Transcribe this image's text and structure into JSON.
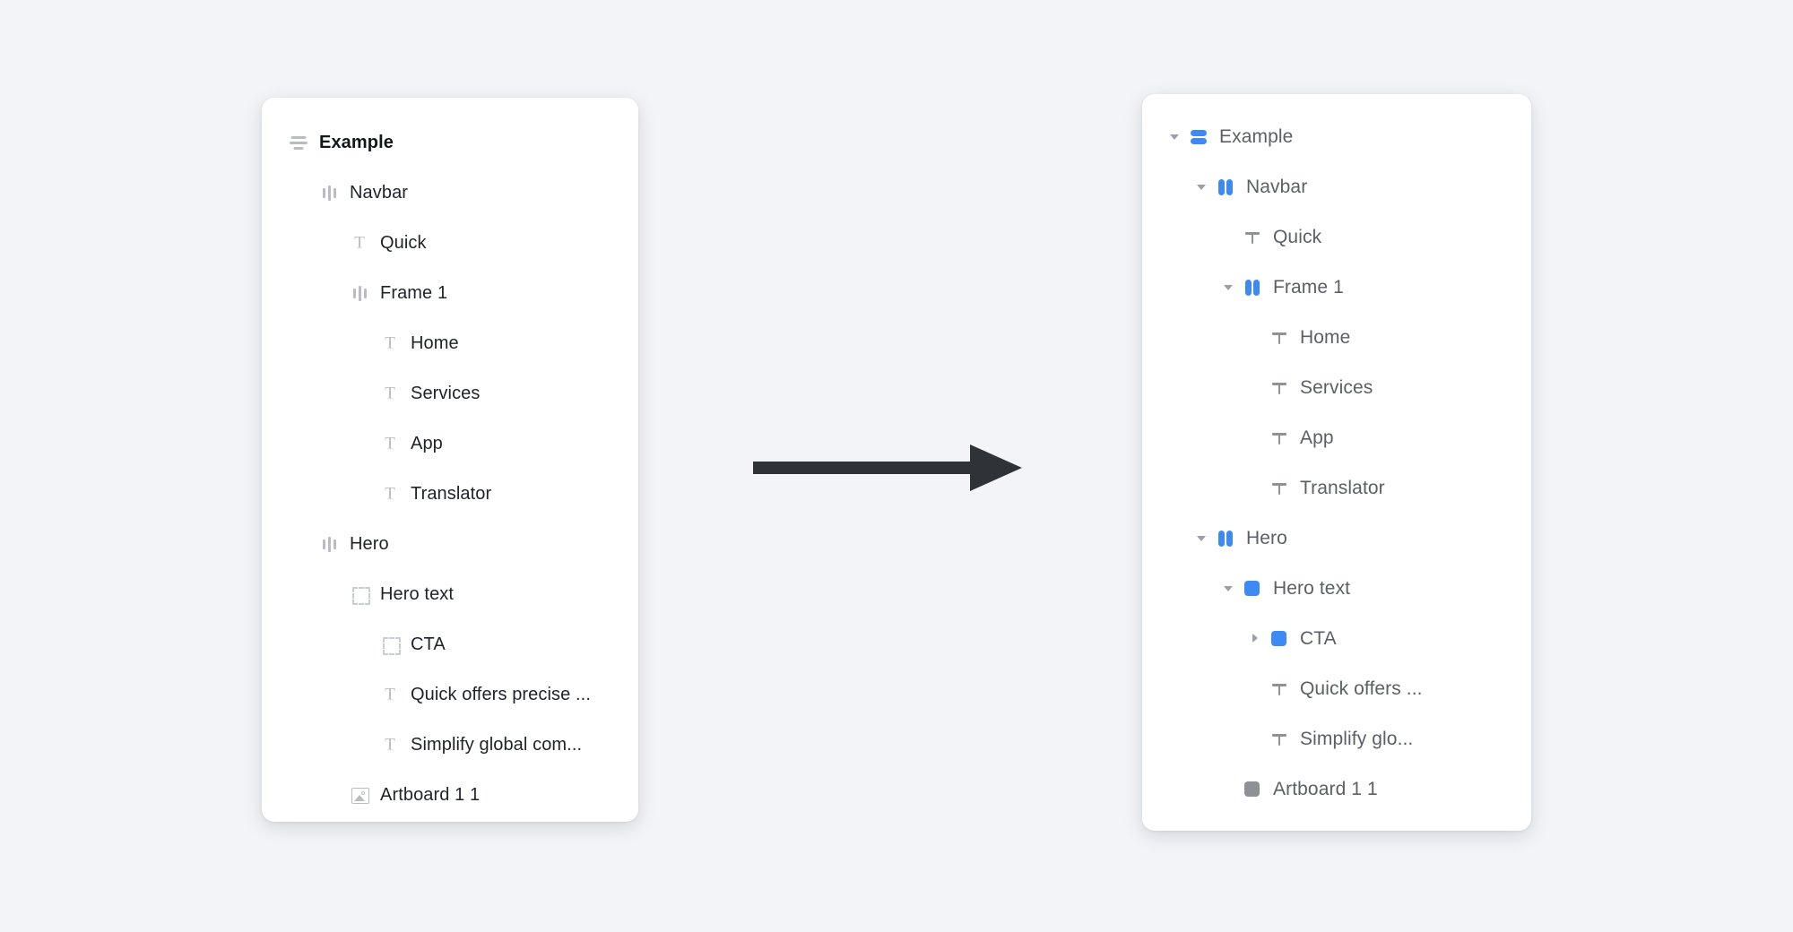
{
  "accent_color": "#3d8bf2",
  "muted_icon_color": "#8e9297",
  "background_color": "#f2f4f7",
  "arrow": {
    "name": "right-arrow",
    "direction": "right",
    "color": "#2f3337"
  },
  "before_panel": {
    "title": "Example",
    "items": [
      {
        "label": "Example",
        "icon": "align-center-icon",
        "depth": 0,
        "twisty": "none",
        "bold": true
      },
      {
        "label": "Navbar",
        "icon": "columns-icon",
        "depth": 1,
        "twisty": "none",
        "bold": false
      },
      {
        "label": "Quick",
        "icon": "text-icon",
        "depth": 2,
        "twisty": "none",
        "bold": false
      },
      {
        "label": "Frame 1",
        "icon": "columns-icon",
        "depth": 2,
        "twisty": "none",
        "bold": false
      },
      {
        "label": "Home",
        "icon": "text-icon",
        "depth": 3,
        "twisty": "none",
        "bold": false
      },
      {
        "label": "Services",
        "icon": "text-icon",
        "depth": 3,
        "twisty": "none",
        "bold": false
      },
      {
        "label": "App",
        "icon": "text-icon",
        "depth": 3,
        "twisty": "none",
        "bold": false
      },
      {
        "label": "Translator",
        "icon": "text-icon",
        "depth": 3,
        "twisty": "none",
        "bold": false
      },
      {
        "label": "Hero",
        "icon": "columns-icon",
        "depth": 1,
        "twisty": "none",
        "bold": false
      },
      {
        "label": "Hero text",
        "icon": "group-icon",
        "depth": 2,
        "twisty": "none",
        "bold": false
      },
      {
        "label": "CTA",
        "icon": "group-icon",
        "depth": 3,
        "twisty": "none",
        "bold": false
      },
      {
        "label": "Quick offers precise ...",
        "icon": "text-icon",
        "depth": 3,
        "twisty": "none",
        "bold": false
      },
      {
        "label": "Simplify global com...",
        "icon": "text-icon",
        "depth": 3,
        "twisty": "none",
        "bold": false
      },
      {
        "label": "Artboard 1 1",
        "icon": "image-icon",
        "depth": 2,
        "twisty": "none",
        "bold": false
      }
    ]
  },
  "after_panel": {
    "title": "Example",
    "items": [
      {
        "label": "Example",
        "icon": "hstack-icon",
        "depth": 0,
        "twisty": "open",
        "tint": "blue"
      },
      {
        "label": "Navbar",
        "icon": "vstack-icon",
        "depth": 1,
        "twisty": "open",
        "tint": "blue"
      },
      {
        "label": "Quick",
        "icon": "text-solid-icon",
        "depth": 2,
        "twisty": "none",
        "tint": "grey"
      },
      {
        "label": "Frame 1",
        "icon": "vstack-icon",
        "depth": 2,
        "twisty": "open",
        "tint": "blue"
      },
      {
        "label": "Home",
        "icon": "text-solid-icon",
        "depth": 3,
        "twisty": "none",
        "tint": "grey"
      },
      {
        "label": "Services",
        "icon": "text-solid-icon",
        "depth": 3,
        "twisty": "none",
        "tint": "grey"
      },
      {
        "label": "App",
        "icon": "text-solid-icon",
        "depth": 3,
        "twisty": "none",
        "tint": "grey"
      },
      {
        "label": "Translator",
        "icon": "text-solid-icon",
        "depth": 3,
        "twisty": "none",
        "tint": "grey"
      },
      {
        "label": "Hero",
        "icon": "vstack-icon",
        "depth": 1,
        "twisty": "open",
        "tint": "blue"
      },
      {
        "label": "Hero text",
        "icon": "square-icon",
        "depth": 2,
        "twisty": "open",
        "tint": "blue"
      },
      {
        "label": "CTA",
        "icon": "square-icon",
        "depth": 3,
        "twisty": "closed",
        "tint": "blue"
      },
      {
        "label": "Quick offers ...",
        "icon": "text-solid-icon",
        "depth": 3,
        "twisty": "none",
        "tint": "grey"
      },
      {
        "label": "Simplify glo...",
        "icon": "text-solid-icon",
        "depth": 3,
        "twisty": "none",
        "tint": "grey"
      },
      {
        "label": "Artboard 1 1",
        "icon": "square-grey-icon",
        "depth": 2,
        "twisty": "none",
        "tint": "grey"
      }
    ]
  }
}
